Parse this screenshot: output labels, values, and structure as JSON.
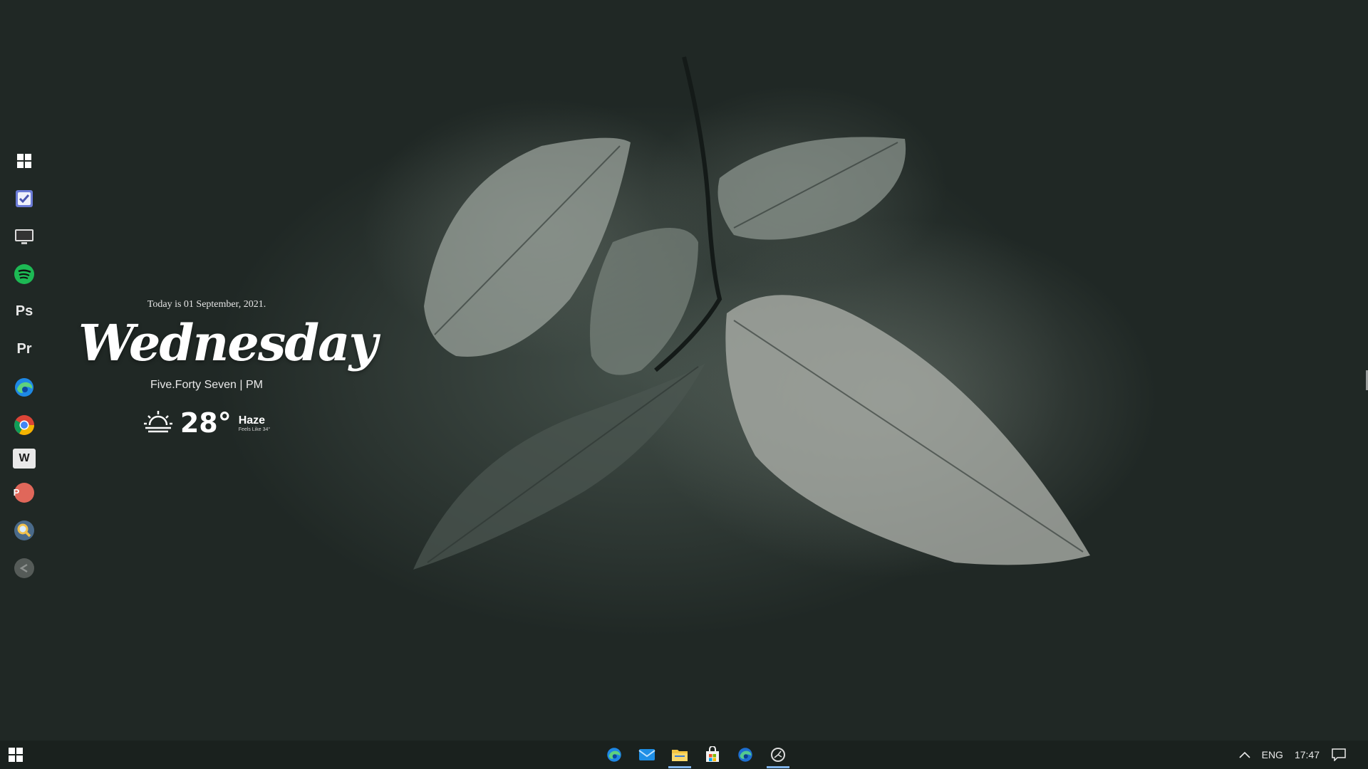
{
  "widget": {
    "date_text": "Today is 01 September, 2021.",
    "day": "Wednesday",
    "time_text": "Five.Forty Seven | PM",
    "weather": {
      "icon": "sunrise-icon",
      "temperature": "28°",
      "condition": "Haze",
      "feels_like": "Feels Like 34°"
    }
  },
  "dock": {
    "items": [
      {
        "name": "windows-icon"
      },
      {
        "name": "todo-icon"
      },
      {
        "name": "monitor-icon"
      },
      {
        "name": "spotify-icon"
      },
      {
        "label": "Ps",
        "name": "photoshop-icon"
      },
      {
        "label": "Pr",
        "name": "premiere-icon"
      },
      {
        "name": "edge-icon"
      },
      {
        "name": "chrome-icon"
      },
      {
        "label": "W",
        "name": "word-icon"
      },
      {
        "label": "P",
        "name": "powerpoint-icon"
      },
      {
        "name": "search-icon"
      },
      {
        "name": "back-icon"
      }
    ]
  },
  "taskbar": {
    "start_icon": "windows-start-icon",
    "pinned": [
      "edge-icon",
      "mail-icon",
      "file-explorer-icon",
      "store-icon",
      "edge-dev-icon",
      "app-icon"
    ],
    "tray": {
      "language": "ENG",
      "clock": "17:47"
    }
  },
  "colors": {
    "accent": "#7fb2e8",
    "background": "#263029"
  }
}
